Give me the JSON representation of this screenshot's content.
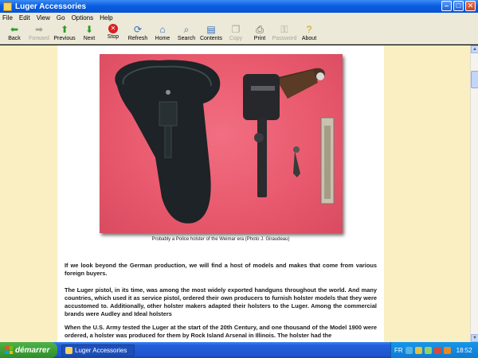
{
  "window": {
    "title": "Luger Accessories"
  },
  "menu": [
    "File",
    "Edit",
    "View",
    "Go",
    "Options",
    "Help"
  ],
  "toolbar": [
    {
      "label": "Back",
      "icon": "back-arrow-icon",
      "enabled": true
    },
    {
      "label": "Forward",
      "icon": "forward-arrow-icon",
      "enabled": false
    },
    {
      "label": "Previous",
      "icon": "up-arrow-icon",
      "enabled": true
    },
    {
      "label": "Next",
      "icon": "down-arrow-icon",
      "enabled": true
    },
    {
      "label": "Stop",
      "icon": "stop-icon",
      "enabled": true
    },
    {
      "label": "Refresh",
      "icon": "refresh-icon",
      "enabled": true
    },
    {
      "label": "Home",
      "icon": "home-icon",
      "enabled": true
    },
    {
      "label": "Search",
      "icon": "search-icon",
      "enabled": true
    },
    {
      "label": "Contents",
      "icon": "contents-icon",
      "enabled": true
    },
    {
      "label": "Copy",
      "icon": "copy-icon",
      "enabled": false
    },
    {
      "label": "Print",
      "icon": "print-icon",
      "enabled": true
    },
    {
      "label": "Password",
      "icon": "password-icon",
      "enabled": false
    },
    {
      "label": "About",
      "icon": "about-icon",
      "enabled": true
    }
  ],
  "content": {
    "caption": "Probably a Police holster of the Weimar era (Photo J. Giraudeau)",
    "paragraphs": [
      "If we look beyond the German production, we will find a host of models and makes that come from various foreign buyers.",
      "The Luger pistol, in its time, was among the most widely exported handguns throughout the world. And many countries, which used it as service pistol, ordered their own producers to furnish holster models that they were accustomed to. Additionally, other holster makers adapted their holsters to the Luger. Among the commercial brands were Audley and Ideal holsters",
      "When the U.S. Army tested the Luger at the start of the 20th Century, and one thousand of the Model 1900 were ordered, a holster was produced for them by Rock Island Arsenal in Illinois. The holster had the"
    ]
  },
  "taskbar": {
    "start_label": "démarrer",
    "task_label": "Luger Accessories",
    "language": "FR",
    "clock": "18:52"
  }
}
